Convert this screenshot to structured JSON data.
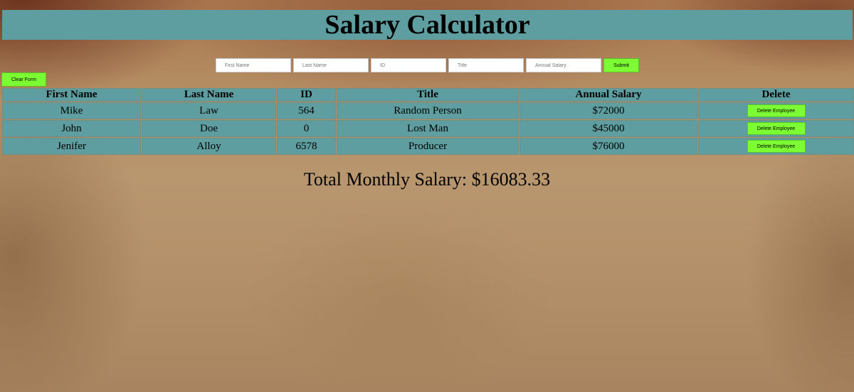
{
  "page": {
    "title": "Salary Calculator"
  },
  "form": {
    "first_name_placeholder": "First Name",
    "last_name_placeholder": "Last Name",
    "id_placeholder": "ID",
    "title_placeholder": "Title",
    "annual_salary_placeholder": "Annual Salary",
    "submit_label": "Submit",
    "clear_label": "Clear Form"
  },
  "table": {
    "headers": [
      "First Name",
      "Last Name",
      "ID",
      "Title",
      "Annual Salary",
      "Delete"
    ],
    "rows": [
      {
        "first_name": "Mike",
        "last_name": "Law",
        "id": "564",
        "title": "Random Person",
        "salary": "$72000",
        "delete_label": "Delete Employee"
      },
      {
        "first_name": "John",
        "last_name": "Doe",
        "id": "0",
        "title": "Lost Man",
        "salary": "$45000",
        "delete_label": "Delete Employee"
      },
      {
        "first_name": "Jenifer",
        "last_name": "Alloy",
        "id": "6578",
        "title": "Producer",
        "salary": "$76000",
        "delete_label": "Delete Employee"
      }
    ]
  },
  "summary": {
    "total_text": "Total Monthly Salary: $16083.33"
  },
  "colors": {
    "header_bar": "#5f9ea0",
    "button_green": "#7cfc32",
    "background": "#b8966e"
  }
}
